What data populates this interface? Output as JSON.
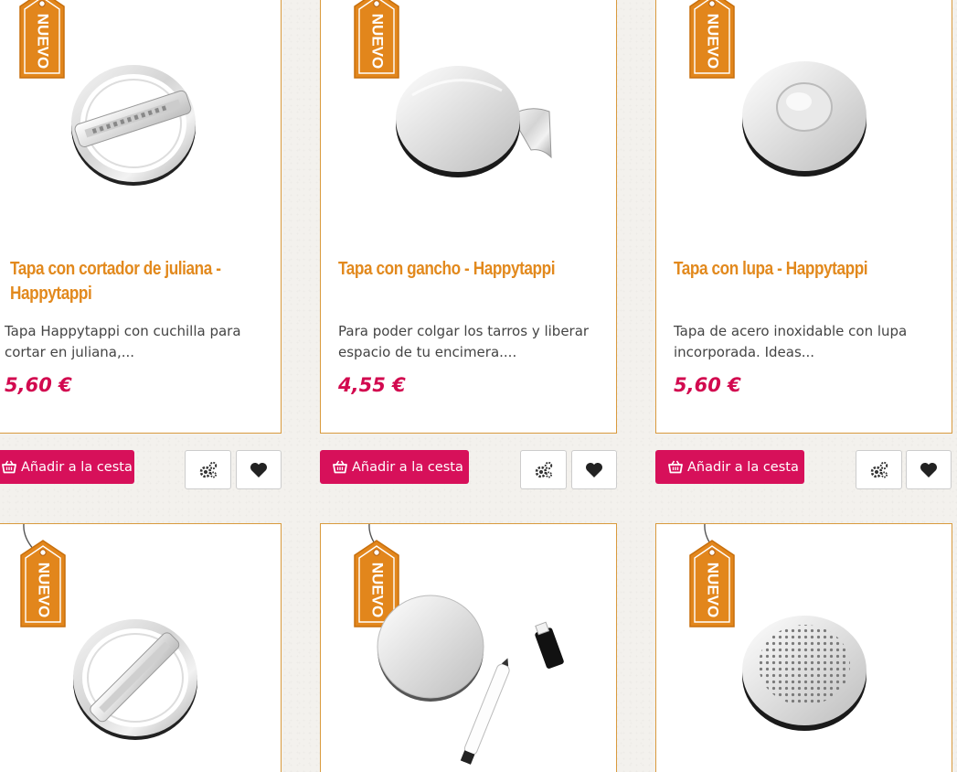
{
  "products": [
    {
      "badge": "NUEVO",
      "title_line1": "Tapa con cortador de juliana -",
      "title_line2": "Happytappi",
      "desc_line1": "Tapa Happytappi con cuchilla para",
      "desc_line2": "cortar en juliana,...",
      "price": "5,60 €"
    },
    {
      "badge": "NUEVO",
      "title_line1": "Tapa con gancho - Happytappi",
      "title_line2": "",
      "desc_line1": "Para poder colgar los tarros y liberar",
      "desc_line2": "espacio de tu encimera....",
      "price": "4,55 €"
    },
    {
      "badge": "NUEVO",
      "title_line1": "Tapa con lupa - Happytappi",
      "title_line2": "",
      "desc_line1": "Tapa de acero inoxidable con lupa",
      "desc_line2": "incorporada. Ideas...",
      "price": "5,60 €"
    },
    {
      "badge": "NUEVO"
    },
    {
      "badge": "NUEVO"
    },
    {
      "badge": "NUEVO"
    }
  ],
  "actions": {
    "add_to_cart": "Añadir a la cesta",
    "compare_icon": "gears-icon",
    "wishlist_icon": "heart-icon",
    "cart_icon": "basket-icon"
  },
  "colors": {
    "title": "#e2891d",
    "price": "#d2094f",
    "button": "#d7105a",
    "card_border": "#d99a3d",
    "badge": "#e2861c"
  }
}
